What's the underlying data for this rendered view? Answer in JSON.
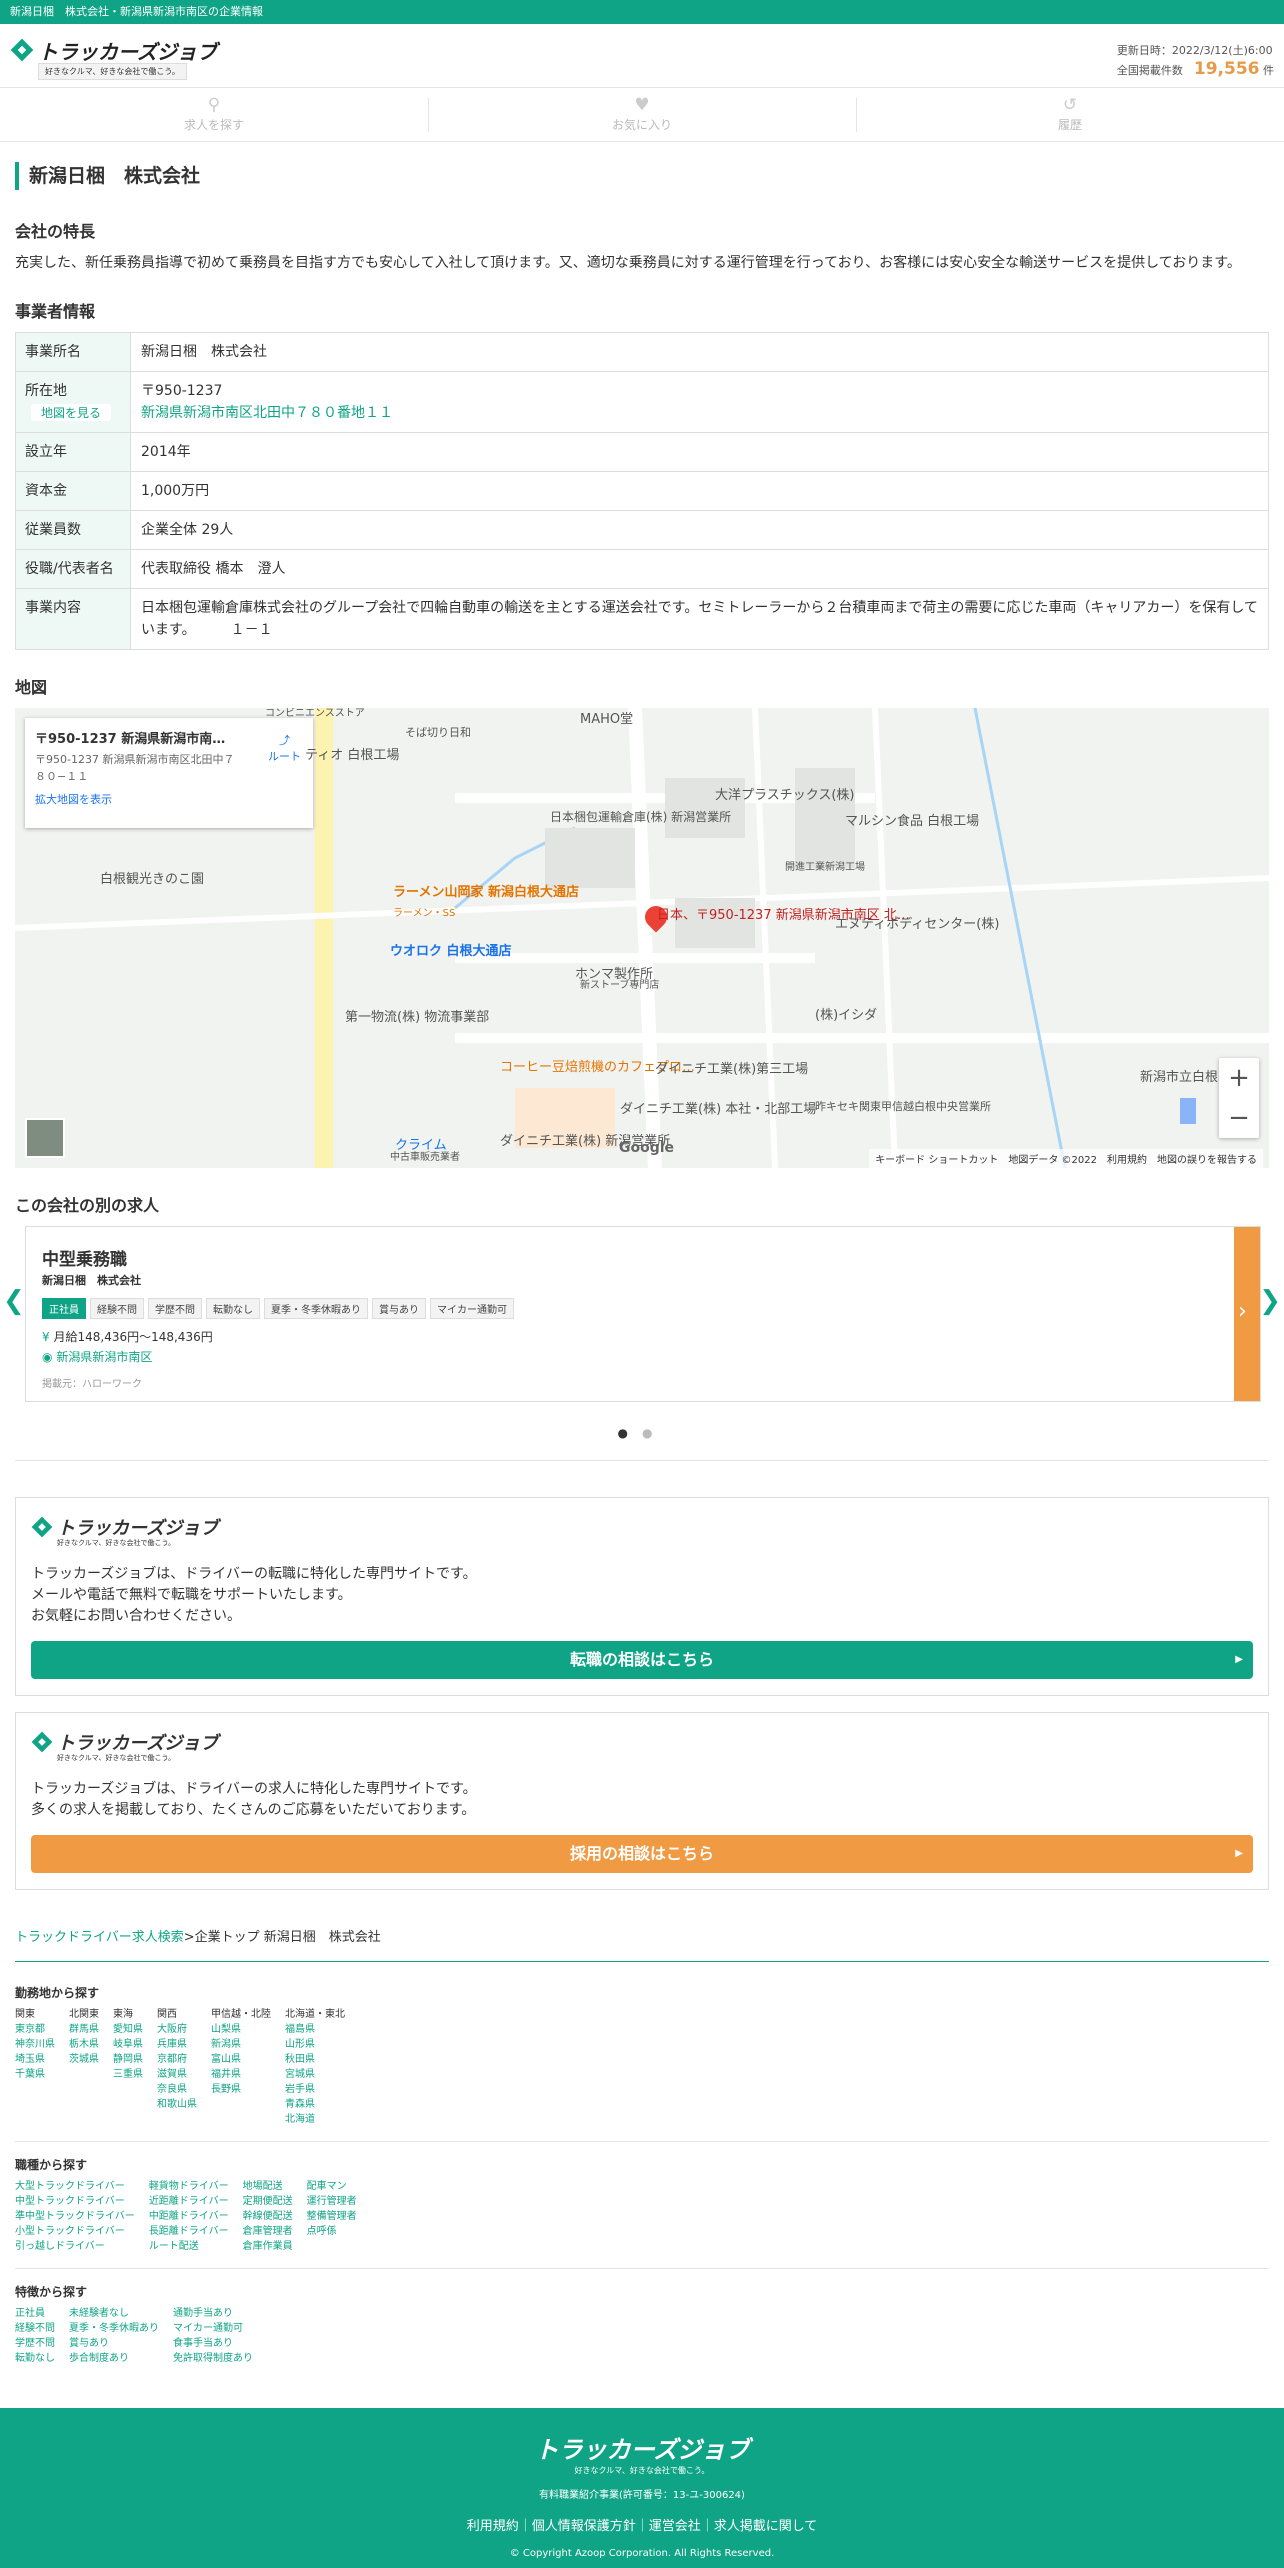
{
  "topbar": {
    "text": "新潟日梱　株式会社・新潟県新潟市南区の企業情報"
  },
  "header": {
    "logo_name": "トラッカーズジョブ",
    "logo_tagline": "好きなクルマ、好きな会社で働こう。",
    "updated": "更新日時：2022/3/12(土)6:00",
    "count_label": "全国掲載件数",
    "count": "19,556",
    "count_unit": "件"
  },
  "nav": [
    {
      "label": "求人を探す",
      "icon": "search-icon"
    },
    {
      "label": "お気に入り",
      "icon": "heart-icon"
    },
    {
      "label": "履歴",
      "icon": "history-icon"
    }
  ],
  "page_title": "新潟日梱　株式会社",
  "features": {
    "heading": "会社の特長",
    "text": "充実した、新任乗務員指導で初めて乗務員を目指す方でも安心して入社して頂けます。又、適切な乗務員に対する運行管理を行っており、お客様には安心安全な輸送サービスを提供しております。"
  },
  "info": {
    "heading": "事業者情報",
    "rows": [
      {
        "label": "事業所名",
        "value": "新潟日梱　株式会社"
      },
      {
        "label": "所在地",
        "value": "〒950-1237",
        "link": "新潟県新潟市南区北田中７８０番地１１",
        "button": "地図を見る"
      },
      {
        "label": "設立年",
        "value": "2014年"
      },
      {
        "label": "資本金",
        "value": "1,000万円"
      },
      {
        "label": "従業員数",
        "value": "企業全体 29人"
      },
      {
        "label": "役職/代表者名",
        "value": "代表取締役 橋本　澄人"
      },
      {
        "label": "事業内容",
        "value": "日本梱包運輸倉庫株式会社のグループ会社で四輪自動車の輸送を主とする運送会社です。セミトレーラーから２台積車両まで荷主の需要に応じた車両（キャリアカー）を保有しています。　　　１－１"
      }
    ]
  },
  "map": {
    "heading": "地図",
    "card_title": "〒950-1237 新潟県新潟市南区...",
    "card_address": "〒950-1237 新潟県新潟市南区北田中７８０−１１",
    "card_route": "ルート",
    "card_link": "拡大地図を表示",
    "marker": "日本、〒950-1237 新潟県新潟市南区 北…",
    "labels": [
      "MAHO堂",
      "そば切り日和",
      "ティオ 白根工場",
      "日本梱包運輸倉庫(株) 新潟営業所",
      "大洋プラスチックス(株)",
      "マルシン食品 白根工場",
      "開進工業新潟工場",
      "白根観光きのこ園",
      "ラーメン山岡家 新潟白根大通店",
      "ラーメン・SS",
      "エヌティボディセンター(株)",
      "ウオロク 白根大通店",
      "ホンマ製作所",
      "新ストーブ専門店",
      "(株)イシダ",
      "第一物流(株) 物流事業部",
      "コーヒー豆焙煎機のカフェプロ…",
      "ダイニチ工業(株)第三工場",
      "ダイニチ工業(株) 本社・北部工場",
      "新潟市立白根",
      "昨キセキ関東甲信越白根中央営業所",
      "クライム",
      "中古車販売業者",
      "ダイニチ工業(株) 新潟営業所",
      "コンビニエンスストア"
    ],
    "google": "Google",
    "footer": "キーボード ショートカット　地図データ ©2022　利用規約　地図の誤りを報告する",
    "zoom_in": "+",
    "zoom_out": "−"
  },
  "other_jobs": {
    "heading": "この会社の別の求人",
    "title": "中型乗務職",
    "company": "新潟日梱　株式会社",
    "tags": [
      "正社員",
      "経験不問",
      "学歴不問",
      "転勤なし",
      "夏季・冬季休暇あり",
      "賞与あり",
      "マイカー通勤可"
    ],
    "salary": "月給148,436円〜148,436円",
    "location": "新潟県新潟市南区",
    "source": "掲載元：ハローワーク"
  },
  "promo1": {
    "text1": "トラッカーズジョブは、ドライバーの転職に特化した専門サイトです。",
    "text2": "メールや電話で無料で転職をサポートいたします。",
    "text3": "お気軽にお問い合わせください。",
    "button": "転職の相談はこちら",
    "color": "#10a487"
  },
  "promo2": {
    "text1": "トラッカーズジョブは、ドライバーの求人に特化した専門サイトです。",
    "text2": "多くの求人を掲載しており、たくさんのご応募をいただいております。",
    "button": "採用の相談はこちら",
    "color": "#f09a44"
  },
  "breadcrumb": {
    "link": "トラックドライバー求人検索",
    "rest": ">企業トップ 新潟日梱　株式会社"
  },
  "links": {
    "area_heading": "勤務地から探す",
    "areas": [
      {
        "h": "関東",
        "items": [
          "東京都",
          "神奈川県",
          "埼玉県",
          "千葉県"
        ]
      },
      {
        "h": "北関東",
        "items": [
          "群馬県",
          "栃木県",
          "茨城県"
        ]
      },
      {
        "h": "東海",
        "items": [
          "愛知県",
          "岐阜県",
          "静岡県",
          "三重県"
        ]
      },
      {
        "h": "関西",
        "items": [
          "大阪府",
          "兵庫県",
          "京都府",
          "滋賀県",
          "奈良県",
          "和歌山県"
        ]
      },
      {
        "h": "甲信越・北陸",
        "items": [
          "山梨県",
          "新潟県",
          "富山県",
          "福井県",
          "長野県"
        ]
      },
      {
        "h": "北海道・東北",
        "items": [
          "福島県",
          "山形県",
          "秋田県",
          "宮城県",
          "岩手県",
          "青森県",
          "北海道"
        ]
      }
    ],
    "job_heading": "職種から探す",
    "jobs": [
      [
        "大型トラックドライバー",
        "中型トラックドライバー",
        "準中型トラックドライバー",
        "小型トラックドライバー",
        "引っ越しドライバー"
      ],
      [
        "軽貨物ドライバー",
        "近距離ドライバー",
        "中距離ドライバー",
        "長距離ドライバー",
        "ルート配送"
      ],
      [
        "地場配送",
        "定期便配送",
        "幹線便配送",
        "倉庫管理者",
        "倉庫作業員"
      ],
      [
        "配車マン",
        "運行管理者",
        "整備管理者",
        "点呼係"
      ]
    ],
    "feat_heading": "特徴から探す",
    "feats": [
      [
        "正社員",
        "経験不問",
        "学歴不問",
        "転勤なし"
      ],
      [
        "未経験者なし",
        "夏季・冬季休暇あり",
        "賞与あり",
        "歩合制度あり"
      ],
      [
        "通勤手当あり",
        "マイカー通勤可",
        "食事手当あり",
        "免許取得制度あり"
      ]
    ]
  },
  "footer": {
    "logo": "トラッカーズジョブ",
    "tagline": "好きなクルマ、好きな会社で働こう。",
    "license": "有料職業紹介事業(許可番号：13-ユ-300624)",
    "links": "利用規約｜個人情報保護方針｜運営会社｜求人掲載に関して",
    "copyright": "© Copyright Azoop Corporation. All Rights Reserved."
  }
}
